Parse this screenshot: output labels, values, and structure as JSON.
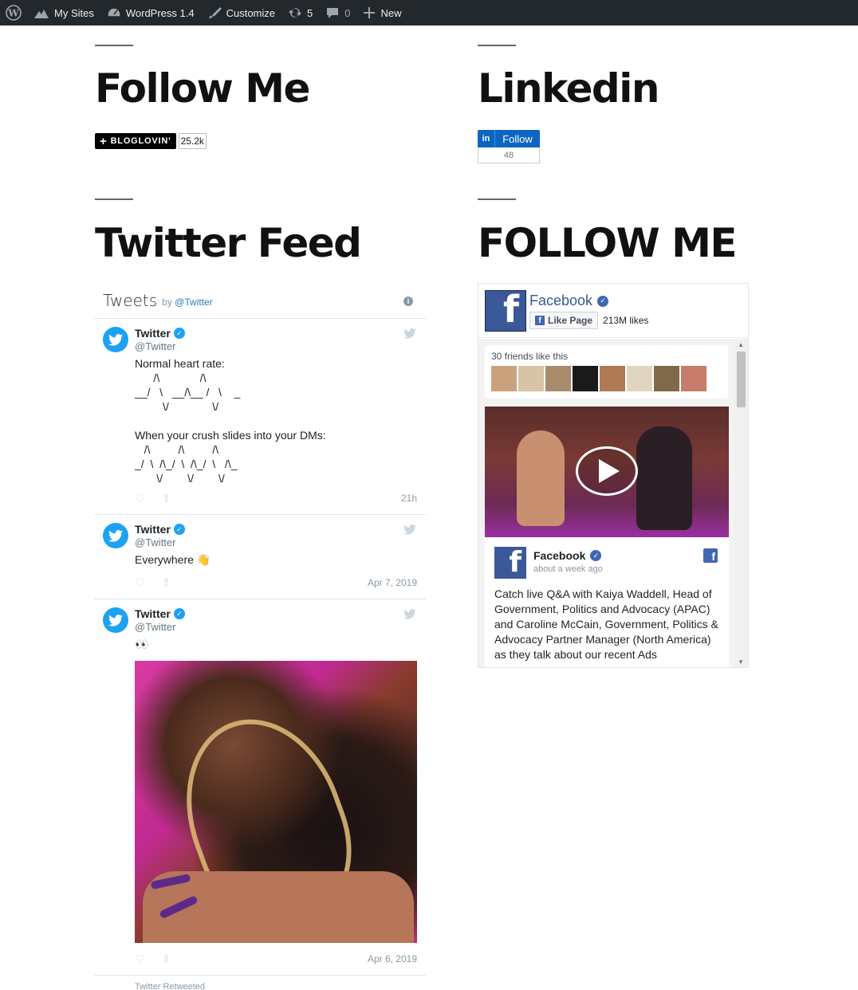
{
  "adminbar": {
    "my_sites": "My Sites",
    "site_name": "WordPress 1.4",
    "customize": "Customize",
    "updates": "5",
    "comments": "0",
    "new": "New"
  },
  "widgets": {
    "follow_me_title": "Follow Me",
    "bloglovin_label": "BLOGLOVIN'",
    "bloglovin_count": "25.2k",
    "linkedin_title": "Linkedin",
    "linkedin_logo": "in",
    "linkedin_follow": "Follow",
    "linkedin_count": "48",
    "twitter_title": "Twitter Feed",
    "follow_me_caps_title": "FOLLOW ME"
  },
  "twitter": {
    "header_title": "Tweets",
    "header_by": "by",
    "header_handle": "@Twitter",
    "tweets": [
      {
        "name": "Twitter",
        "handle": "@Twitter",
        "text": "Normal heart rate:\n      /\\             /\\\n__/   \\   __/\\__ /   \\    _\n         \\/              \\/\n\nWhen your crush slides into your DMs:\n   /\\         /\\         /\\\n_/  \\  /\\_/  \\  /\\_/  \\   /\\_\n       \\/        \\/        \\/",
        "date": "21h"
      },
      {
        "name": "Twitter",
        "handle": "@Twitter",
        "text": "Everywhere 👋",
        "date": "Apr 7, 2019"
      },
      {
        "name": "Twitter",
        "handle": "@Twitter",
        "text": "👀",
        "date": "Apr 6, 2019"
      }
    ],
    "retweeted_label": "Twitter Retweeted"
  },
  "facebook": {
    "page_name": "Facebook",
    "like_button": "Like Page",
    "likes": "213M likes",
    "friends_label": "30 friends like this",
    "friend_colors": [
      "#c9a27d",
      "#d8c3a5",
      "#a88b6b",
      "#1a1a1a",
      "#b07a55",
      "#e0d6c0",
      "#7f6a4a",
      "#c77b6a"
    ],
    "post_name": "Facebook",
    "post_time": "about a week ago",
    "post_text": "Catch live Q&A with Kaiya Waddell, Head of Government, Politics and Advocacy (APAC) and Caroline McCain, Government, Politics & Advocacy Partner Manager (North America) as they talk about our recent Ads"
  }
}
